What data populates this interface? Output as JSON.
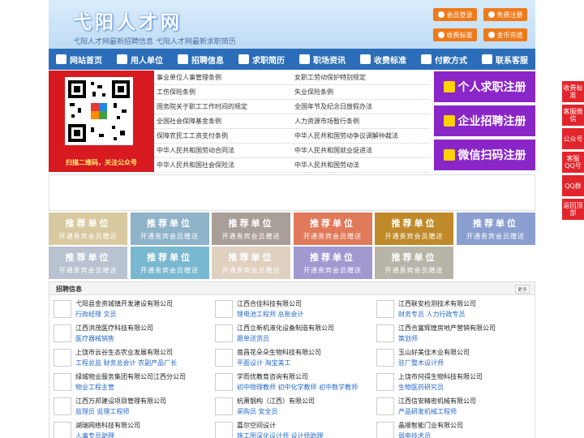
{
  "header": {
    "logo": "弋阳人才网",
    "slogan": "弋阳人才网最新招聘信息   弋阳人才网最新求职简历",
    "buttons": [
      "会员登录",
      "免费注册",
      "收费标准",
      "金币充值"
    ]
  },
  "nav": [
    "网站首页",
    "用人单位",
    "招聘信息",
    "求职简历",
    "职场资讯",
    "收费标准",
    "付款方式",
    "联系客服"
  ],
  "qr_caption": "扫描二维码，关注公众号",
  "laws": [
    [
      "事业单位人事管理条例",
      "女职工劳动保护特别规定"
    ],
    [
      "工伤保险条例",
      "失业保险条例"
    ],
    [
      "国务院关于职工工作时间的规定",
      "全国年节及纪念日放假办法"
    ],
    [
      "全国社会保障基金条例",
      "人力资源市场暂行条例"
    ],
    [
      "保障农民工工资支付条例",
      "中华人民共和国劳动争议调解仲裁法"
    ],
    [
      "中华人民共和国劳动合同法",
      "中华人民共和国就业促进法"
    ],
    [
      "中华人民共和国社会保险法",
      "中华人民共和国劳动法"
    ]
  ],
  "register": [
    "个人求职注册",
    "企业招聘注册",
    "微信扫码注册"
  ],
  "recommend": {
    "title": "推荐单位",
    "subtitle": "开通贵宾会员赠送"
  },
  "recommend_colors": [
    "#d8c9a0",
    "#8fb3c8",
    "#a8a098",
    "#e07a5a",
    "#c08a2a",
    "#8a9fd0",
    "#b8c2d0",
    "#7ab8d0",
    "#e0d0c0",
    "#a09ad0",
    "#b8b4a8"
  ],
  "jobs": {
    "title": "招聘信息",
    "more": "更多",
    "items": [
      {
        "company": "弋阳县金资城镇开发建设有限公司",
        "positions": "行政经理 文员"
      },
      {
        "company": "江西合佳科技有限公司",
        "positions": "锂电池工程师 总账会计"
      },
      {
        "company": "江西联安检测技术有限公司",
        "positions": "财务专员 人力行政专员"
      },
      {
        "company": "江西洪茂医疗科技有限公司",
        "positions": "医疗器械销售"
      },
      {
        "company": "江西立新机液化设备制造有限公司",
        "positions": "跟单送货员"
      },
      {
        "company": "江西合富辉煌房地产营销有限公司",
        "positions": "策划师"
      },
      {
        "company": "上饶市云谷生态农业发展有限公司",
        "positions": "工程总监 财务总会计 农副产品厂长"
      },
      {
        "company": "南昌花朵朵生物科技有限公司",
        "positions": "平面设计 淘宝美工"
      },
      {
        "company": "玉山好美佳木业有限公司",
        "positions": "驻厂整木设计师"
      },
      {
        "company": "绿城物业服务集团有限公司江西分公司",
        "positions": "物业工程主管"
      },
      {
        "company": "学而优教育咨询有限公司",
        "positions": "初中物理教师 初中化学教师 初中数学教师"
      },
      {
        "company": "上饶市何得生物科技有限公司",
        "positions": "生物医药研究员"
      },
      {
        "company": "江西万邦建设项目管理有限公司",
        "positions": "监理员 监理工程师"
      },
      {
        "company": "杭萧钢构（江西）有限公司",
        "positions": "采购员 安全员"
      },
      {
        "company": "江西信安精密机械有限公司",
        "positions": "产品研发机械工程师"
      },
      {
        "company": "湖瑞网络科技有限公司",
        "positions": "人事专员助理"
      },
      {
        "company": "嘉尔空间设计",
        "positions": "施工图深化设计师 设计师助理"
      },
      {
        "company": "晶顺智能门业有限公司",
        "positions": "弱电技术员"
      }
    ]
  },
  "side": [
    "收费标准",
    "客服微信",
    "公众号",
    "客服QQ号",
    "QQ群",
    "返回顶部"
  ]
}
